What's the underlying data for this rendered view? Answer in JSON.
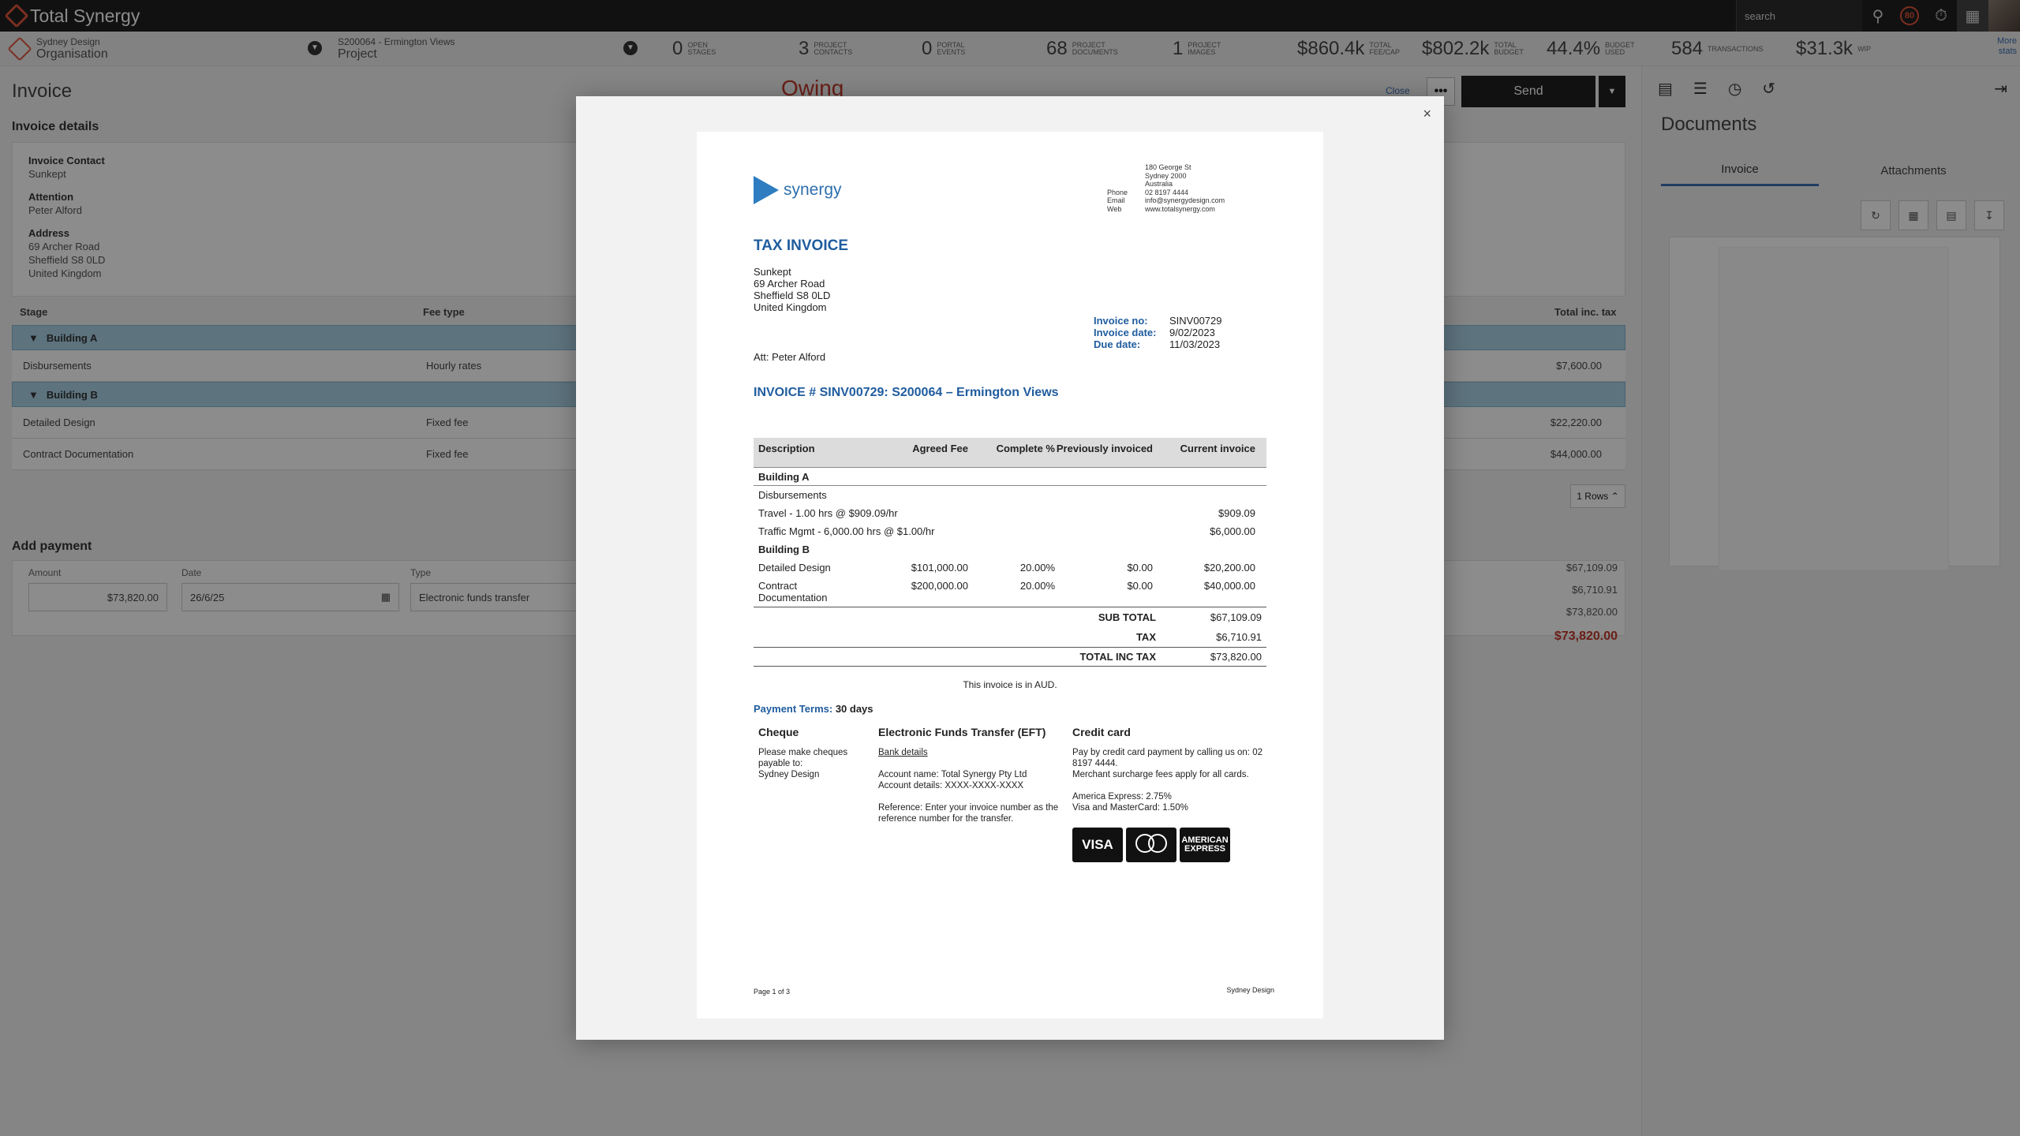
{
  "app": {
    "name": "Total Synergy",
    "search_placeholder": "search",
    "badge": "80"
  },
  "context": {
    "org_small": "Sydney Design",
    "org_big": "Organisation",
    "project_small": "S200064 - Ermington Views",
    "project_big": "Project"
  },
  "stats": [
    {
      "value": "0",
      "label": "OPEN STAGES"
    },
    {
      "value": "3",
      "label": "PROJECT CONTACTS"
    },
    {
      "value": "0",
      "label": "PORTAL EVENTS"
    },
    {
      "value": "68",
      "label": "PROJECT DOCUMENTS"
    },
    {
      "value": "1",
      "label": "PROJECT IMAGES"
    },
    {
      "value": "$860.4k",
      "label": "TOTAL FEE/CAP"
    },
    {
      "value": "$802.2k",
      "label": "TOTAL BUDGET"
    },
    {
      "value": "44.4%",
      "label": "BUDGET USED"
    },
    {
      "value": "584",
      "label": "TRANSACTIONS"
    },
    {
      "value": "$31.3k",
      "label": "WIP"
    }
  ],
  "more_stats": "More stats",
  "page": {
    "title": "Invoice",
    "status": "Owing",
    "close": "Close",
    "more": "•••",
    "send": "Send",
    "send_drop": "▼",
    "details_heading": "Invoice details",
    "contact_label": "Invoice Contact",
    "contact": "Sunkept",
    "attention_label": "Attention",
    "attention": "Peter Alford",
    "address_label": "Address",
    "address1": "69 Archer Road",
    "address2": "Sheffield  S8 0LD",
    "address3": "United Kingdom",
    "col_stage": "Stage",
    "col_fee_type": "Fee type",
    "col_total": "Total inc. tax",
    "group_a": "Building A",
    "group_b": "Building B",
    "rows": [
      {
        "stage": "Disbursements",
        "fee_type": "Hourly rates",
        "total": "$7,600.00"
      },
      {
        "stage": "Detailed Design",
        "fee_type": "Fixed fee",
        "total": "$22,220.00"
      },
      {
        "stage": "Contract Documentation",
        "fee_type": "Fixed fee",
        "total": "$44,000.00"
      }
    ],
    "rows_btn": "1 Rows ⌃",
    "payment_heading": "Add payment",
    "amount_label": "Amount",
    "amount": "$73,820.00",
    "date_label": "Date",
    "date": "26/6/25",
    "type_label": "Type",
    "type": "Electronic funds transfer",
    "sum1": "$67,109.09",
    "sum2": "$6,710.91",
    "sum3": "$73,820.00",
    "sum_total": "$73,820.00"
  },
  "documents": {
    "title": "Documents",
    "tab_invoice": "Invoice",
    "tab_attachments": "Attachments"
  },
  "modal": {
    "close": "×"
  },
  "invoice": {
    "brand": "synergy",
    "firm": [
      {
        "k": "",
        "v": "180 George St"
      },
      {
        "k": "",
        "v": "Sydney  2000"
      },
      {
        "k": "",
        "v": "Australia"
      },
      {
        "k": "Phone",
        "v": "02 8197 4444"
      },
      {
        "k": "Email",
        "v": "info@synergydesign.com"
      },
      {
        "k": "Web",
        "v": "www.totalsynergy.com"
      }
    ],
    "title": "TAX INVOICE",
    "billto": [
      "Sunkept",
      "69 Archer Road",
      "Sheffield  S8 0LD",
      "United Kingdom"
    ],
    "no_label": "Invoice no:",
    "no": "SINV00729",
    "date_label": "Invoice date:",
    "date": "9/02/2023",
    "due_label": "Due date:",
    "due": "11/03/2023",
    "att": "Att:  Peter Alford",
    "heading": "INVOICE # SINV00729:  S200064 – Ermington Views",
    "cols": {
      "desc": "Description",
      "agreed": "Agreed Fee",
      "complete": "Complete %",
      "prev": "Previously invoiced",
      "current": "Current invoice"
    },
    "group_a": "Building A",
    "disb": "Disbursements",
    "travel": "Travel - 1.00 hrs @ $909.09/hr",
    "travel_amt": "$909.09",
    "traffic": "Traffic Mgmt - 6,000.00 hrs @ $1.00/hr",
    "traffic_amt": "$6,000.00",
    "group_b": "Building B",
    "dd": {
      "desc": "Detailed Design",
      "agreed": "$101,000.00",
      "complete": "20.00%",
      "prev": "$0.00",
      "current": "$20,200.00"
    },
    "cd": {
      "desc": "Contract Documentation",
      "agreed": "$200,000.00",
      "complete": "20.00%",
      "prev": "$0.00",
      "current": "$40,000.00"
    },
    "subtotal_label": "SUB TOTAL",
    "subtotal": "$67,109.09",
    "tax_label": "TAX",
    "tax": "$6,710.91",
    "total_label": "TOTAL INC TAX",
    "total": "$73,820.00",
    "aud_note": "This invoice is in AUD.",
    "terms_label": "Payment Terms:",
    "terms": "30 days",
    "cheque_title": "Cheque",
    "cheque_1": "Please make cheques payable to:",
    "cheque_2": "Sydney Design",
    "eft_title": "Electronic Funds Transfer (EFT)",
    "eft_link": "Bank details",
    "eft_1": "Account name: Total Synergy Pty Ltd",
    "eft_2": "Account details: XXXX-XXXX-XXXX",
    "eft_3": "Reference: Enter your invoice number as the reference number for the transfer.",
    "cc_title": "Credit card",
    "cc_1": "Pay by credit card payment by calling us on: 02 8197 4444.",
    "cc_2": "Merchant surcharge fees apply for all cards.",
    "cc_3": "America Express: 2.75%",
    "cc_4": "Visa and MasterCard: 1.50%",
    "card_visa": "VISA",
    "card_amex": "AMERICAN EXPRESS",
    "footer_left": "Page 1 of 3",
    "footer_right": "Sydney Design"
  },
  "colors": {
    "accent": "#3b6db3",
    "brand_red": "#e0543b",
    "owing": "#c0392b",
    "invoice_blue": "#1f5c9e"
  }
}
